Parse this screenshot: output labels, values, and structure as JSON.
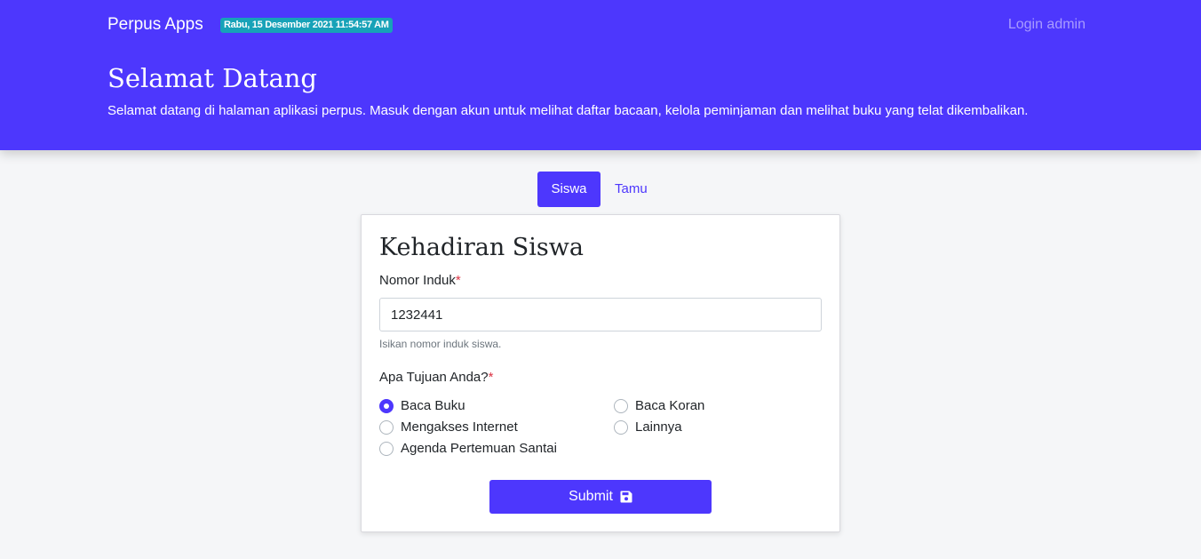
{
  "navbar": {
    "brand": "Perpus Apps",
    "datetime_badge": "Rabu, 15 Desember 2021 11:54:57 AM",
    "login_link": "Login admin"
  },
  "hero": {
    "title": "Selamat Datang",
    "text": "Selamat datang di halaman aplikasi perpus. Masuk dengan akun untuk melihat daftar bacaan, kelola peminjaman dan melihat buku yang telat dikembalikan."
  },
  "tabs": [
    {
      "label": "Siswa",
      "active": true
    },
    {
      "label": "Tamu",
      "active": false
    }
  ],
  "form": {
    "title": "Kehadiran Siswa",
    "nomor_induk": {
      "label": "Nomor Induk",
      "required_mark": "*",
      "value": "1232441",
      "help": "Isikan nomor induk siswa."
    },
    "tujuan": {
      "label": "Apa Tujuan Anda?",
      "required_mark": "*",
      "options": [
        {
          "label": "Baca Buku",
          "checked": true
        },
        {
          "label": "Baca Koran",
          "checked": false
        },
        {
          "label": "Mengakses Internet",
          "checked": false
        },
        {
          "label": "Lainnya",
          "checked": false
        },
        {
          "label": "Agenda Pertemuan Santai",
          "checked": false
        }
      ]
    },
    "submit_label": "Submit",
    "submit_icon": "floppy-disk-icon"
  },
  "colors": {
    "primary": "#4d37fd",
    "badge": "#17a2b8",
    "required": "#dc3545",
    "page_bg": "#f5f6f8"
  }
}
